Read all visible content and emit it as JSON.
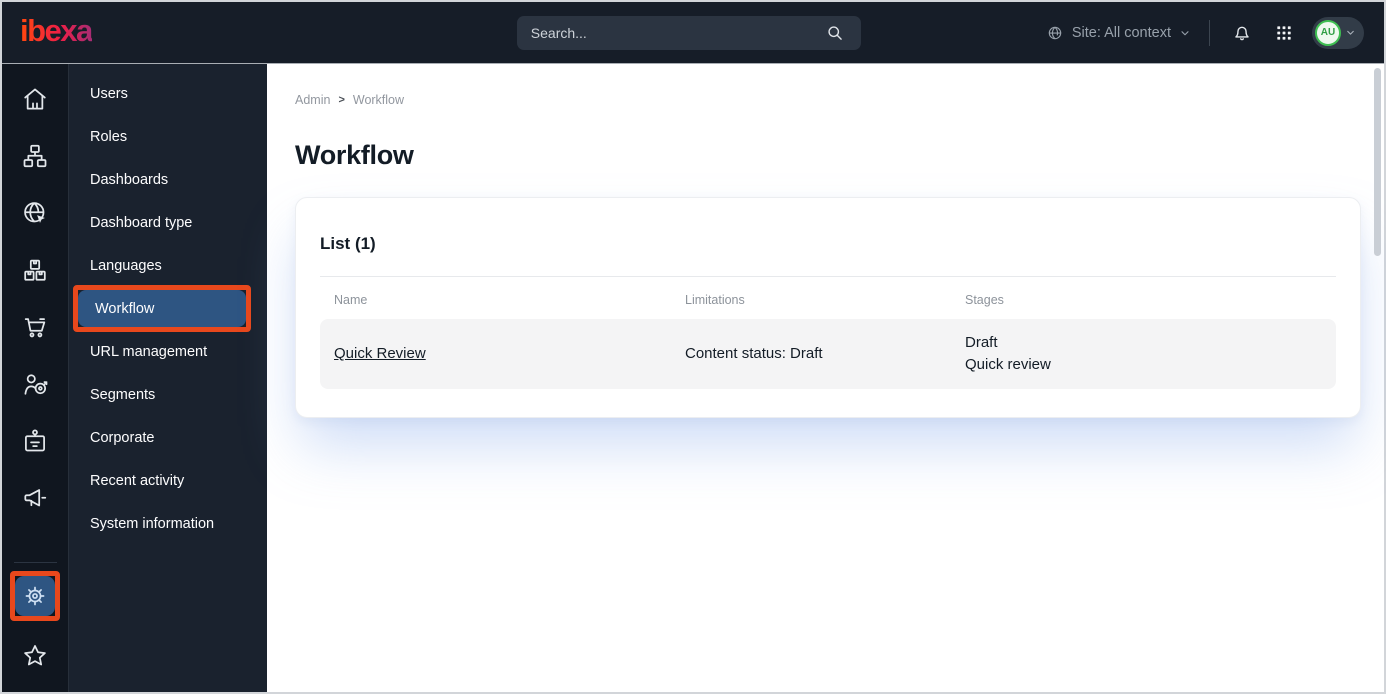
{
  "topbar": {
    "logo_text": "ibexa",
    "search_placeholder": "Search...",
    "site_label": "Site: All context",
    "avatar_initials": "AU"
  },
  "iconrail": {
    "icons": [
      "home",
      "content-tree",
      "site",
      "product-catalog",
      "commerce",
      "customers",
      "corporate",
      "marketing"
    ],
    "bottom_icons": [
      "settings",
      "favorites"
    ]
  },
  "sidebar": {
    "items": [
      {
        "label": "Users"
      },
      {
        "label": "Roles"
      },
      {
        "label": "Dashboards"
      },
      {
        "label": "Dashboard type"
      },
      {
        "label": "Languages"
      },
      {
        "label": "Workflow",
        "active": true
      },
      {
        "label": "URL management"
      },
      {
        "label": "Segments"
      },
      {
        "label": "Corporate"
      },
      {
        "label": "Recent activity"
      },
      {
        "label": "System information"
      }
    ]
  },
  "breadcrumb": {
    "items": [
      "Admin",
      "Workflow"
    ],
    "separator": ">"
  },
  "page": {
    "title": "Workflow"
  },
  "list_card": {
    "title": "List (1)",
    "columns": [
      "Name",
      "Limitations",
      "Stages"
    ],
    "rows": [
      {
        "name": "Quick Review",
        "limitations": "Content status: Draft",
        "stages": [
          "Draft",
          "Quick review"
        ]
      }
    ]
  },
  "colors": {
    "topbar_bg": "#161d28",
    "rail_bg": "#10161f",
    "panel_bg": "#1a222e",
    "active_item_blue": "#2e5582",
    "annotation_orange": "#e8481c",
    "avatar_green": "#3fbf52",
    "logo_gradient_start": "#ff4413",
    "logo_gradient_end": "#a62c74"
  }
}
